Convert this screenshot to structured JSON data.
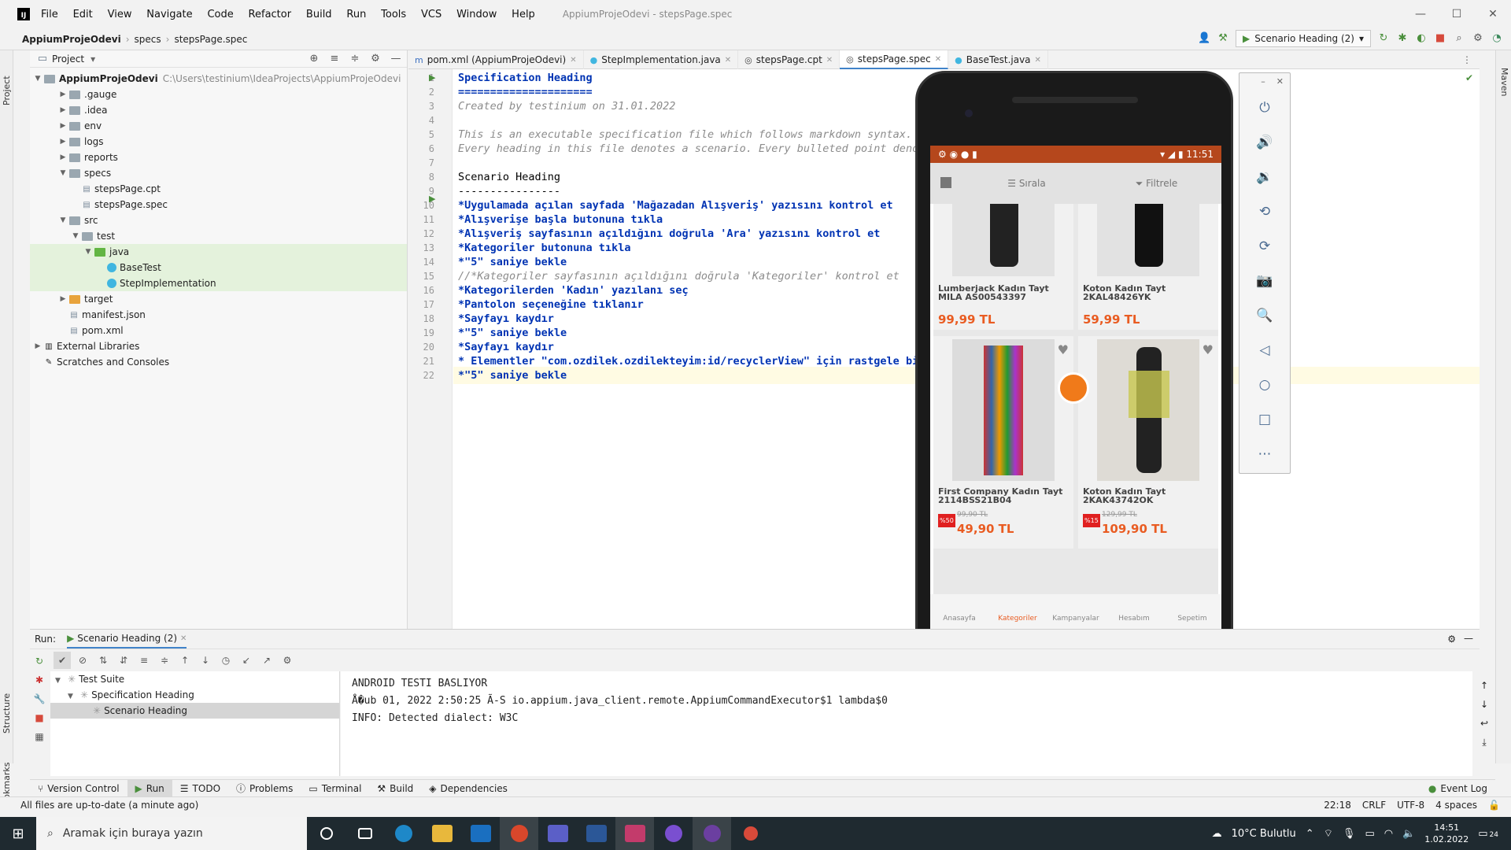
{
  "window": {
    "title": "AppiumProjeOdevi - stepsPage.spec",
    "menu": [
      "File",
      "Edit",
      "View",
      "Navigate",
      "Code",
      "Refactor",
      "Build",
      "Run",
      "Tools",
      "VCS",
      "Window",
      "Help"
    ],
    "controls": {
      "minimize": "—",
      "maximize": "☐",
      "close": "✕"
    }
  },
  "navbar": {
    "project": "AppiumProjeOdevi",
    "folder": "specs",
    "file": "stepsPage.spec",
    "run_config": "Scenario Heading (2)"
  },
  "side_tabs": {
    "project": "Project",
    "structure": "Structure",
    "bookmarks": "Bookmarks",
    "maven": "Maven"
  },
  "project_panel": {
    "title": "Project",
    "root": {
      "name": "AppiumProjeOdevi",
      "path": "C:\\Users\\testinium\\IdeaProjects\\AppiumProjeOdevi"
    },
    "items": [
      {
        "name": ".gauge",
        "depth": 1,
        "kind": "folder",
        "expanded": false
      },
      {
        "name": ".idea",
        "depth": 1,
        "kind": "folder",
        "expanded": false
      },
      {
        "name": "env",
        "depth": 1,
        "kind": "folder",
        "expanded": false
      },
      {
        "name": "logs",
        "depth": 1,
        "kind": "folder",
        "expanded": false
      },
      {
        "name": "reports",
        "depth": 1,
        "kind": "folder",
        "expanded": false
      },
      {
        "name": "specs",
        "depth": 1,
        "kind": "folder",
        "expanded": true
      },
      {
        "name": "stepsPage.cpt",
        "depth": 2,
        "kind": "file"
      },
      {
        "name": "stepsPage.spec",
        "depth": 2,
        "kind": "file"
      },
      {
        "name": "src",
        "depth": 1,
        "kind": "folder",
        "expanded": true
      },
      {
        "name": "test",
        "depth": 2,
        "kind": "folder",
        "expanded": true
      },
      {
        "name": "java",
        "depth": 3,
        "kind": "java",
        "expanded": true
      },
      {
        "name": "BaseTest",
        "depth": 4,
        "kind": "class"
      },
      {
        "name": "StepImplementation",
        "depth": 4,
        "kind": "class"
      },
      {
        "name": "target",
        "depth": 1,
        "kind": "target",
        "expanded": false
      },
      {
        "name": "manifest.json",
        "depth": 1,
        "kind": "file"
      },
      {
        "name": "pom.xml",
        "depth": 1,
        "kind": "file"
      },
      {
        "name": "External Libraries",
        "depth": 0,
        "kind": "lib",
        "expanded": false
      },
      {
        "name": "Scratches and Consoles",
        "depth": 0,
        "kind": "scratch"
      }
    ]
  },
  "tabs": [
    {
      "label": "pom.xml (AppiumProjeOdevi)",
      "icon": "m",
      "active": false
    },
    {
      "label": "StepImplementation.java",
      "icon": "C",
      "active": false
    },
    {
      "label": "stepsPage.cpt",
      "icon": "G",
      "active": false
    },
    {
      "label": "stepsPage.spec",
      "icon": "G",
      "active": true
    },
    {
      "label": "BaseTest.java",
      "icon": "C",
      "active": false
    }
  ],
  "code": [
    {
      "n": "1",
      "t": "Specification Heading",
      "s": "head"
    },
    {
      "n": "2",
      "t": "=====================",
      "s": "head"
    },
    {
      "n": "3",
      "t": "Created by testinium on 31.01.2022",
      "s": "comment"
    },
    {
      "n": "4",
      "t": "",
      "s": "plain"
    },
    {
      "n": "5",
      "t": "This is an executable specification file which follows markdown syntax.",
      "s": "comment"
    },
    {
      "n": "6",
      "t": "Every heading in this file denotes a scenario. Every bulleted point denot",
      "s": "comment"
    },
    {
      "n": "7",
      "t": "",
      "s": "plain"
    },
    {
      "n": "8",
      "t": "Scenario Heading",
      "s": "plain"
    },
    {
      "n": "9",
      "t": "----------------",
      "s": "plain"
    },
    {
      "n": "10",
      "t": "*Uygulamada açılan sayfada 'Mağazadan Alışveriş' yazısını kontrol et",
      "s": "step"
    },
    {
      "n": "11",
      "t": "*Alışverişe başla butonuna tıkla",
      "s": "step"
    },
    {
      "n": "12",
      "t": "*Alışveriş sayfasının açıldığını doğrula 'Ara' yazısını kontrol et",
      "s": "step"
    },
    {
      "n": "13",
      "t": "*Kategoriler butonuna tıkla",
      "s": "step"
    },
    {
      "n": "14",
      "t": "*\"5\" saniye bekle",
      "s": "step"
    },
    {
      "n": "15",
      "t": "//*Kategoriler sayfasının açıldığını doğrula 'Kategoriler' kontrol et",
      "s": "comment"
    },
    {
      "n": "16",
      "t": "*Kategorilerden 'Kadın' yazılanı seç",
      "s": "step"
    },
    {
      "n": "17",
      "t": "*Pantolon seçeneğine tıklanır",
      "s": "step"
    },
    {
      "n": "18",
      "t": "*Sayfayı kaydır",
      "s": "step"
    },
    {
      "n": "19",
      "t": "*\"5\" saniye bekle",
      "s": "step"
    },
    {
      "n": "20",
      "t": "*Sayfayı kaydır",
      "s": "step"
    },
    {
      "n": "21",
      "t": "* Elementler \"com.ozdilek.ozdilekteyim:id/recyclerView\" için rastgele bir",
      "s": "step"
    },
    {
      "n": "22",
      "t": "*\"5\" saniye bekle",
      "s": "step"
    }
  ],
  "emulator": {
    "status_time": "11:51",
    "toolbar": {
      "sort": "Sırala",
      "filter": "Filtrele"
    },
    "products": [
      {
        "name": "Lumberjack Kadın Tayt MILA AS00543397",
        "price": "99,99 TL",
        "old_price": "",
        "discount": ""
      },
      {
        "name": "Koton Kadın Tayt 2KAL48426YK",
        "price": "59,99 TL",
        "old_price": "",
        "discount": ""
      },
      {
        "name": "First Company Kadın Tayt 2114BSS21B04",
        "price": "49,90 TL",
        "old_price": "99,90 TL",
        "discount": "%50"
      },
      {
        "name": "Koton Kadın Tayt 2KAK43742OK",
        "price": "109,90 TL",
        "old_price": "129,99 TL",
        "discount": "%15"
      }
    ],
    "bottom_nav": [
      "Anasayfa",
      "Kategoriler",
      "Kampanyalar",
      "Hesabım",
      "Sepetim"
    ],
    "side_controls": [
      "power-icon",
      "volume-up-icon",
      "volume-down-icon",
      "rotate-left-icon",
      "rotate-right-icon",
      "camera-icon",
      "zoom-icon",
      "back-icon",
      "home-icon",
      "overview-icon",
      "more-icon"
    ]
  },
  "run_panel": {
    "label": "Run:",
    "config": "Scenario Heading (2)",
    "tree": [
      {
        "label": "Test Suite",
        "depth": 0
      },
      {
        "label": "Specification Heading",
        "depth": 1
      },
      {
        "label": "Scenario Heading",
        "depth": 2
      }
    ],
    "console": [
      "ANDROID TESTI BASLIYOR",
      "Å�ub 01, 2022 2:50:25 Ã-S io.appium.java_client.remote.AppiumCommandExecutor$1 lambda$0",
      "INFO: Detected dialect: W3C"
    ]
  },
  "tool_tabs": [
    "Version Control",
    "Run",
    "TODO",
    "Problems",
    "Terminal",
    "Build",
    "Dependencies"
  ],
  "event_log": "Event Log",
  "statusline": {
    "message": "All files are up-to-date (a minute ago)",
    "position": "22:18",
    "line_sep": "CRLF",
    "encoding": "UTF-8",
    "indent": "4 spaces"
  },
  "taskbar": {
    "search_placeholder": "Aramak için buraya yazın",
    "weather": "10°C  Bulutlu",
    "time": "14:51",
    "date": "1.02.2022",
    "notifications": "24"
  }
}
